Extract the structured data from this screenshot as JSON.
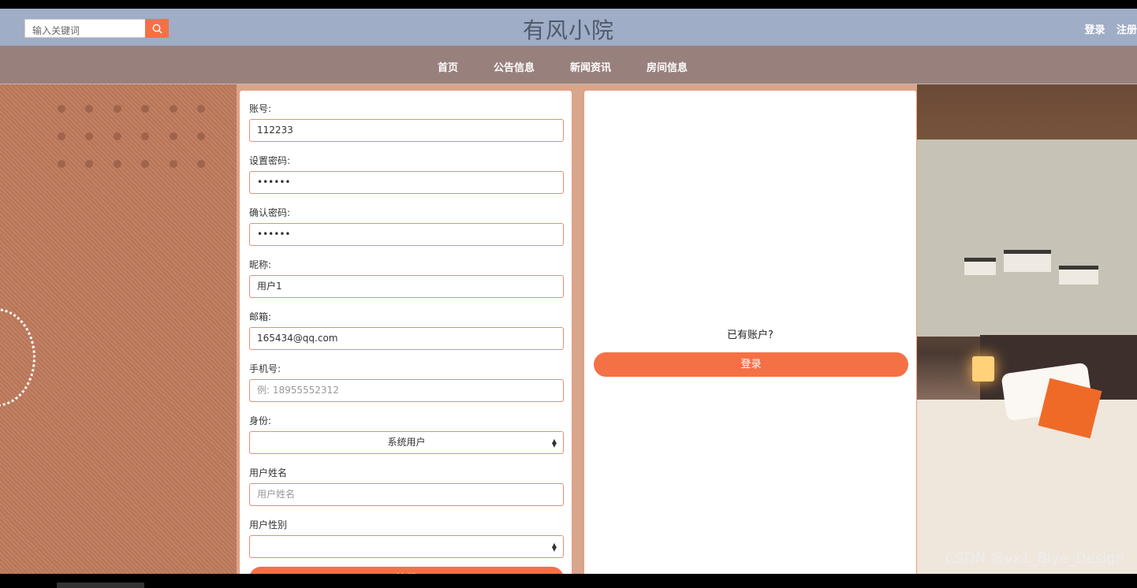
{
  "header": {
    "search_placeholder": "输入关键词",
    "site_title": "有风小院",
    "login_link": "登录",
    "register_link": "注册"
  },
  "nav": {
    "items": [
      "首页",
      "公告信息",
      "新闻资讯",
      "房间信息"
    ]
  },
  "form": {
    "fields": [
      {
        "label": "账号:",
        "value": "112233",
        "placeholder": ""
      },
      {
        "label": "设置密码:",
        "value": "••••••",
        "placeholder": ""
      },
      {
        "label": "确认密码:",
        "value": "••••••",
        "placeholder": ""
      },
      {
        "label": "昵称:",
        "value": "用户1",
        "placeholder": ""
      },
      {
        "label": "邮箱:",
        "value": "165434@qq.com",
        "placeholder": ""
      },
      {
        "label": "手机号:",
        "value": "",
        "placeholder": "例: 18955552312"
      },
      {
        "label": "身份:",
        "value": "系统用户",
        "placeholder": ""
      },
      {
        "label": "用户姓名",
        "value": "",
        "placeholder": "用户姓名"
      },
      {
        "label": "用户性别",
        "value": "",
        "placeholder": ""
      }
    ],
    "submit_label": "注册"
  },
  "side": {
    "has_account_text": "已有账户?",
    "login_button": "登录"
  },
  "watermark": "CSDN @vx1_Biye_Design",
  "colors": {
    "accent": "#f47146",
    "header_bg": "#9fadc6",
    "nav_bg": "#98807d"
  }
}
